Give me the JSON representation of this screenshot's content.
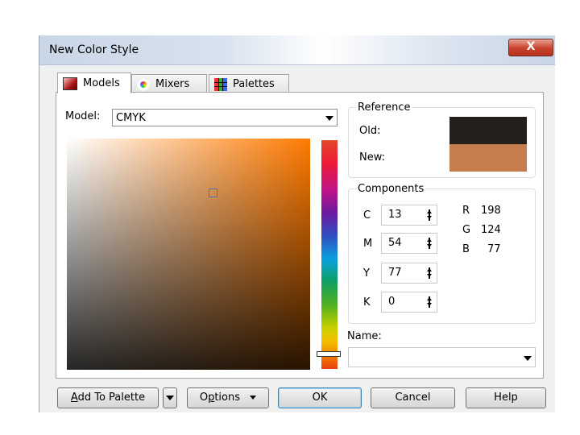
{
  "window": {
    "title": "New Color Style",
    "close_label": "X"
  },
  "tabs": [
    {
      "label": "Models",
      "icon": "models-icon"
    },
    {
      "label": "Mixers",
      "icon": "mixers-icon"
    },
    {
      "label": "Palettes",
      "icon": "palettes-icon"
    }
  ],
  "model": {
    "label": "Model:",
    "value": "CMYK"
  },
  "reference": {
    "title": "Reference",
    "old_label": "Old:",
    "new_label": "New:",
    "old_color": "#231f1c",
    "new_color": "#c67c4d"
  },
  "components": {
    "title": "Components",
    "fields": [
      {
        "label": "C",
        "value": "13"
      },
      {
        "label": "M",
        "value": "54"
      },
      {
        "label": "Y",
        "value": "77"
      },
      {
        "label": "K",
        "value": "0"
      }
    ],
    "rgb": [
      {
        "label": "R",
        "value": "198"
      },
      {
        "label": "G",
        "value": "124"
      },
      {
        "label": "B",
        "value": "77"
      }
    ]
  },
  "name": {
    "label": "Name:",
    "value": ""
  },
  "buttons": {
    "add_to_palette_first": "A",
    "add_to_palette_rest": "dd To Palette",
    "options_pre": "O",
    "options_ul": "p",
    "options_rest": "tions",
    "ok": "OK",
    "cancel": "Cancel",
    "help": "Help"
  },
  "colors": {
    "accent": "#ff7a00",
    "selected": "#c67c4d"
  }
}
